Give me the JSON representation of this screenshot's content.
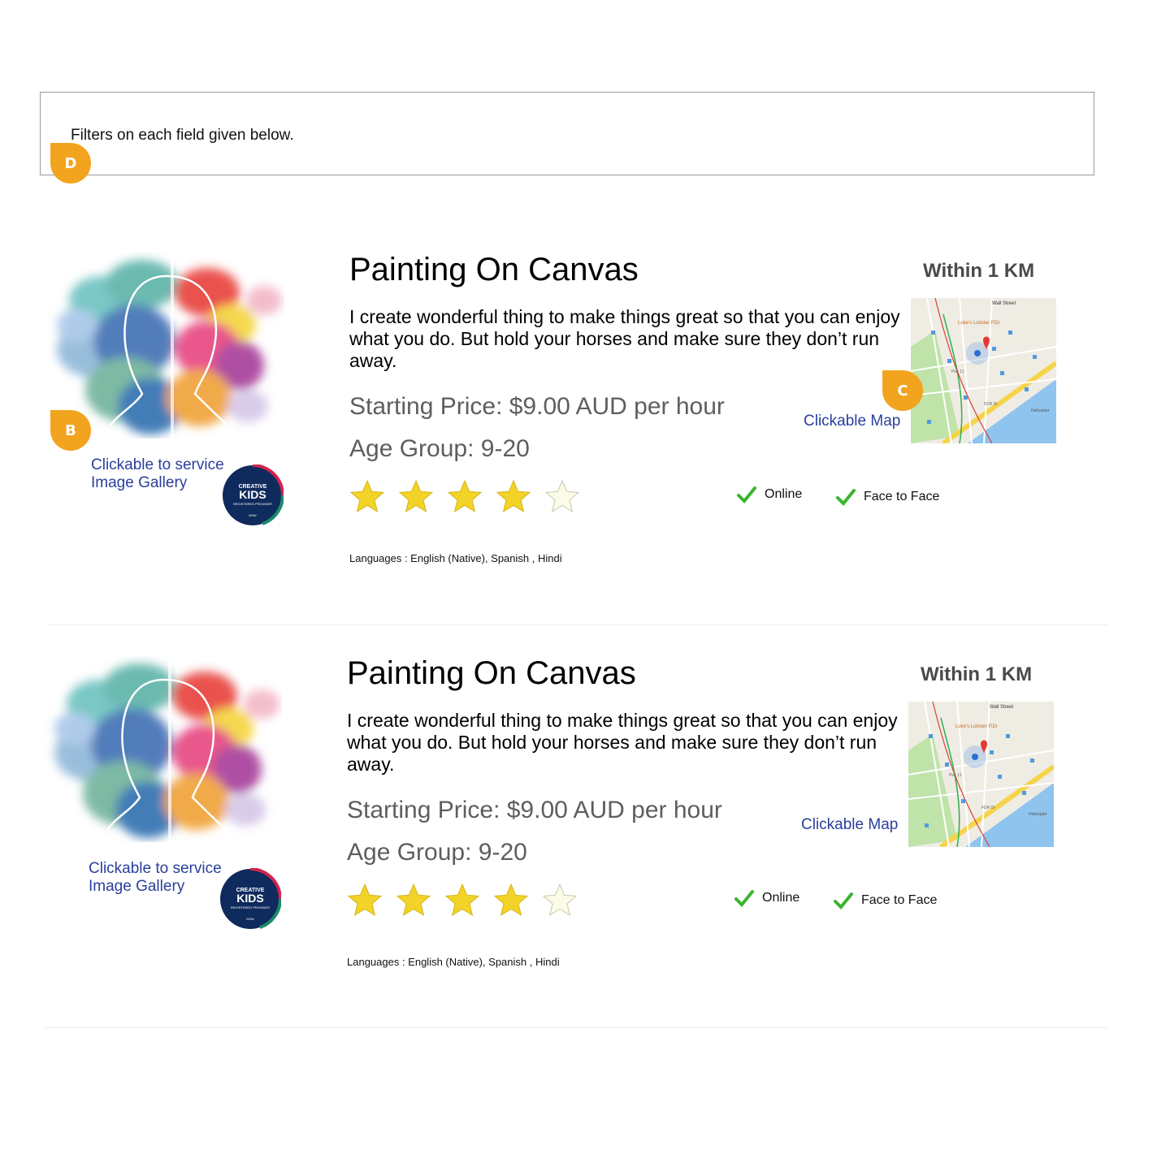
{
  "filters": {
    "text": "Filters on each field given below."
  },
  "markers": {
    "b": "B",
    "c": "C",
    "d": "D"
  },
  "badge": {
    "line1": "CREATIVE",
    "line2": "KIDS",
    "line3": "REGISTERED PROVIDER",
    "line4": "NSW"
  },
  "listings": [
    {
      "title": "Painting On Canvas",
      "description": "I create wonderful thing to make things great so that you can enjoy what you do. But hold your horses and make sure they don’t run away.",
      "price": "Starting Price: $9.00 AUD per hour",
      "age_group": "Age Group: 9-20",
      "rating": 4,
      "rating_max": 5,
      "modes": [
        "Online",
        "Face to Face"
      ],
      "languages": "Languages : English (Native), Spanish , Hindi",
      "distance": "Within 1 KM",
      "gallery_link": "Clickable to service Image Gallery",
      "map_link": "Clickable Map"
    },
    {
      "title": "Painting On Canvas",
      "description": "I create wonderful thing to make things great so that you can enjoy what you do. But hold your horses and make sure they don’t run away.",
      "price": "Starting Price: $9.00 AUD per hour",
      "age_group": "Age Group: 9-20",
      "rating": 4,
      "rating_max": 5,
      "modes": [
        "Online",
        "Face to Face"
      ],
      "languages": "Languages : English (Native), Spanish , Hindi",
      "distance": "Within 1 KM",
      "gallery_link": "Clickable to service Image Gallery",
      "map_link": "Clickable Map"
    }
  ],
  "map_labels": {
    "street": "Wall Street",
    "place": "Luke's Lobster FiDi",
    "heliport": "Helicopter",
    "drive": "FDR Dr",
    "pier": "Pier 11"
  },
  "colors": {
    "marker": "#f2a41f",
    "link": "#2a3f9c",
    "star_filled": "#f2d327",
    "star_empty": "#fbfbe8",
    "check": "#3bb52d",
    "badge": "#0f2a5c"
  }
}
